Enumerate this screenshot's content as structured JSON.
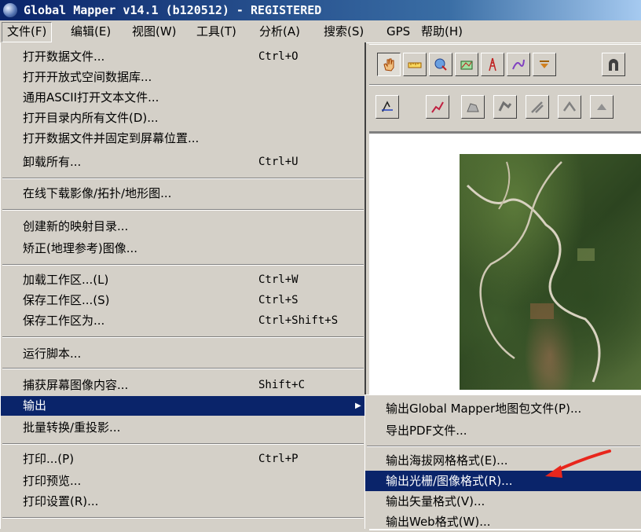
{
  "window": {
    "title": "Global Mapper v14.1 (b120512) - REGISTERED"
  },
  "menubar": [
    "文件(F)",
    "编辑(E)",
    "视图(W)",
    "工具(T)",
    "分析(A)",
    "搜索(S)",
    "GPS",
    "帮助(H)"
  ],
  "file_menu": {
    "items": [
      {
        "label": "打开数据文件...",
        "shortcut": "Ctrl+O"
      },
      {
        "label": "打开开放式空间数据库...",
        "shortcut": ""
      },
      {
        "label": "通用ASCII打开文本文件...",
        "shortcut": ""
      },
      {
        "label": "打开目录内所有文件(D)...",
        "shortcut": ""
      },
      {
        "label": "打开数据文件并固定到屏幕位置...",
        "shortcut": ""
      },
      {
        "label": "卸载所有...",
        "shortcut": "Ctrl+U"
      },
      {
        "label": "在线下载影像/拓扑/地形图...",
        "shortcut": ""
      },
      {
        "label": "创建新的映射目录...",
        "shortcut": ""
      },
      {
        "label": "矫正(地理参考)图像...",
        "shortcut": ""
      },
      {
        "label": "加载工作区...(L)",
        "shortcut": "Ctrl+W"
      },
      {
        "label": "保存工作区...(S)",
        "shortcut": "Ctrl+S"
      },
      {
        "label": "保存工作区为...",
        "shortcut": "Ctrl+Shift+S"
      },
      {
        "label": "运行脚本...",
        "shortcut": ""
      },
      {
        "label": "捕获屏幕图像内容...",
        "shortcut": "Shift+C"
      },
      {
        "label": "输出",
        "shortcut": ""
      },
      {
        "label": "批量转换/重投影...",
        "shortcut": ""
      },
      {
        "label": "打印...(P)",
        "shortcut": "Ctrl+P"
      },
      {
        "label": "打印预览...",
        "shortcut": ""
      },
      {
        "label": "打印设置(R)...",
        "shortcut": ""
      }
    ]
  },
  "export_submenu": {
    "items": [
      {
        "label": "输出Global Mapper地图包文件(P)..."
      },
      {
        "label": "导出PDF文件..."
      },
      {
        "label": "输出海拔网格格式(E)..."
      },
      {
        "label": "输出光栅/图像格式(R)..."
      },
      {
        "label": "输出矢量格式(V)..."
      },
      {
        "label": "输出Web格式(W)..."
      }
    ]
  },
  "colors": {
    "selection": "#0a246a",
    "menu_bg": "#d4d0c8",
    "annotation_arrow": "#e8261c"
  }
}
